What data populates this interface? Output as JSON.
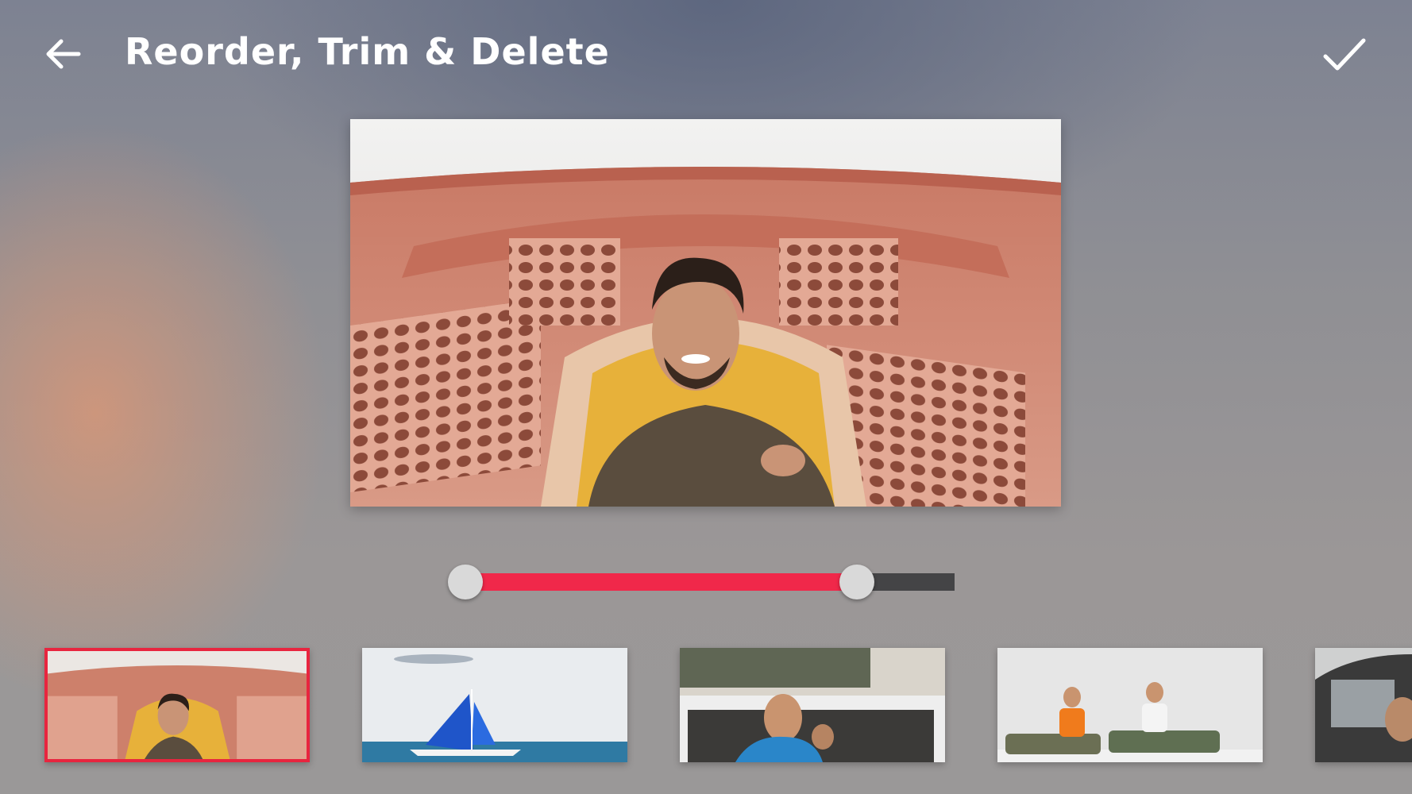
{
  "header": {
    "title": "Reorder, Trim & Delete",
    "back_icon": "arrow-left-icon",
    "confirm_icon": "check-icon"
  },
  "colors": {
    "accent": "#f0284a",
    "track": "#444446",
    "handle": "#d9d9d9",
    "selected_border": "#e8253f"
  },
  "trim": {
    "start_fraction": 0.0,
    "end_fraction": 0.8
  },
  "clips": [
    {
      "subject": "selfie-pink-palace",
      "selected": true
    },
    {
      "subject": "blue-sailboat-sea",
      "selected": false
    },
    {
      "subject": "man-in-car-window",
      "selected": false
    },
    {
      "subject": "two-men-on-car-roof",
      "selected": false
    },
    {
      "subject": "car-interior-partial",
      "selected": false
    }
  ]
}
